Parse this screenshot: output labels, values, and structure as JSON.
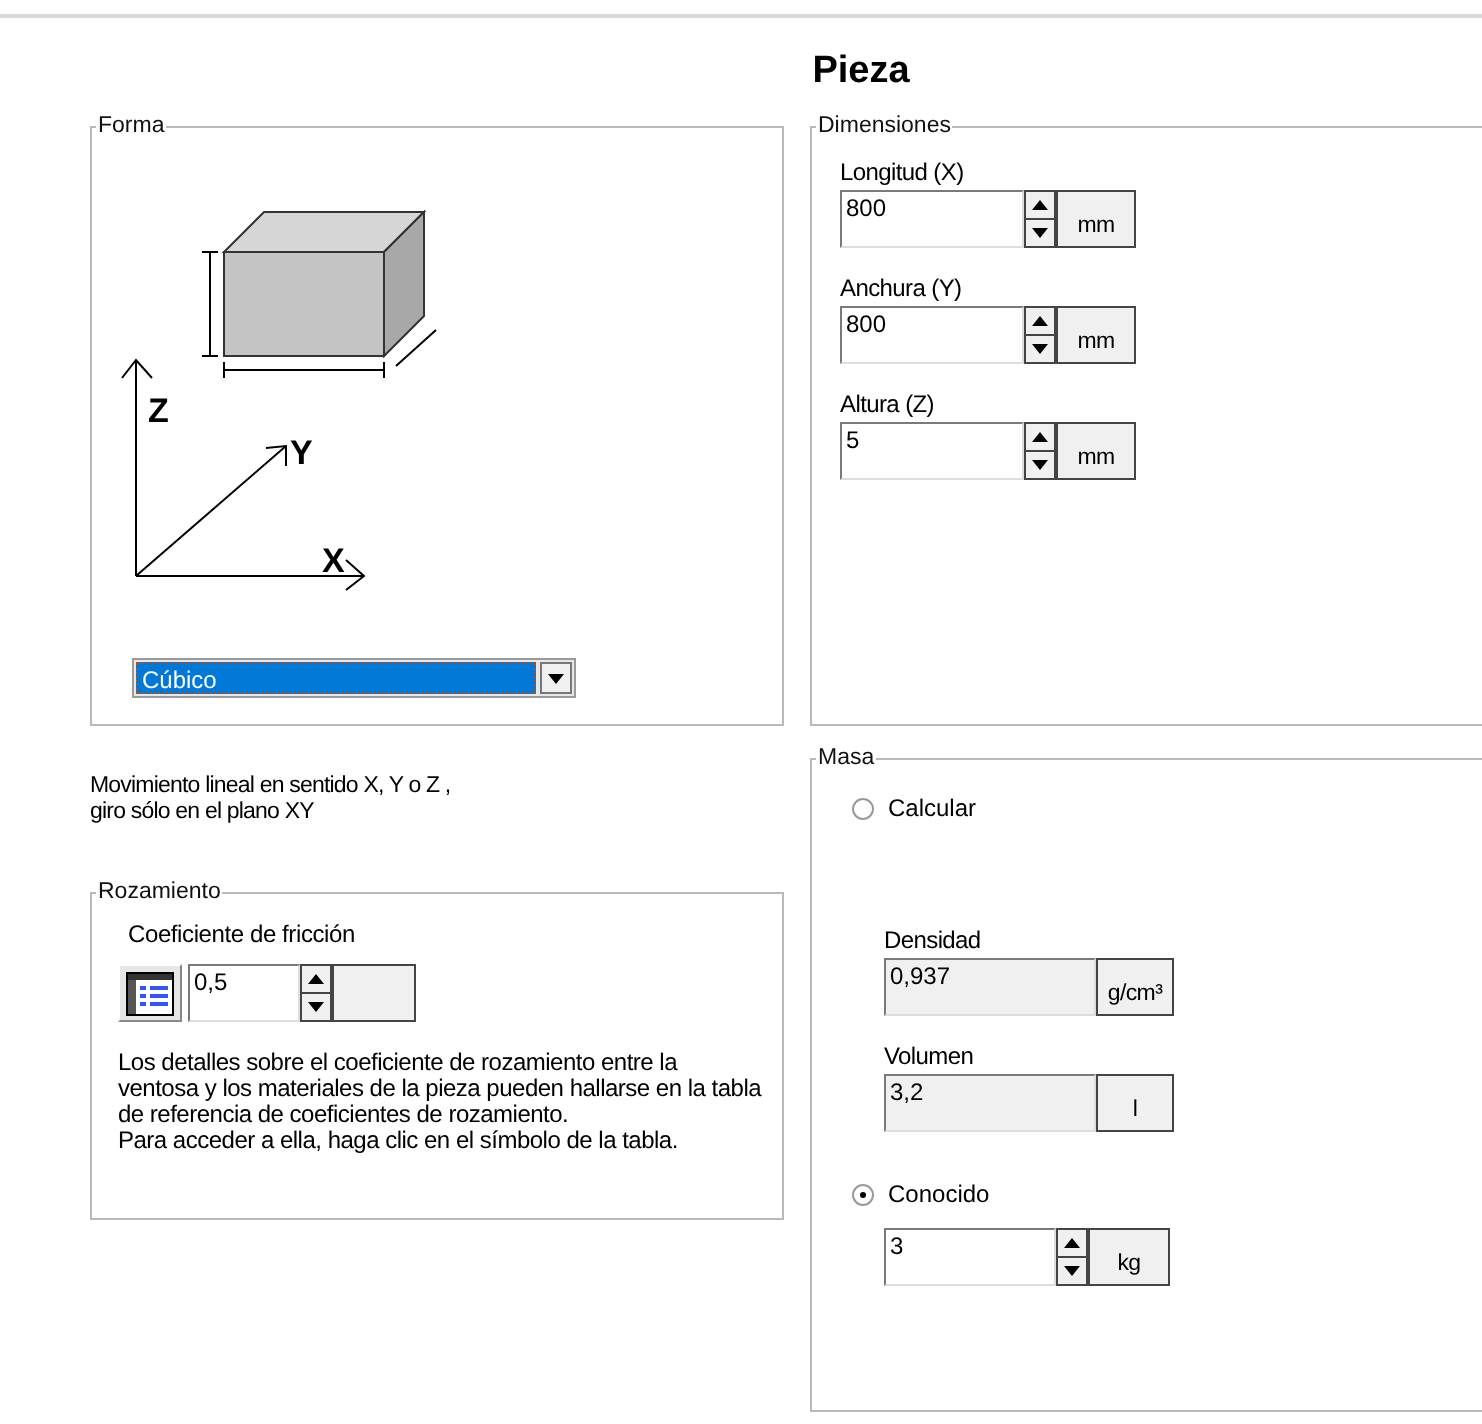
{
  "title": "Pieza",
  "shape": {
    "legend": "Forma",
    "axis_labels": [
      "Z",
      "Y",
      "X"
    ],
    "dropdown": {
      "value": "Cúbico"
    }
  },
  "dimensions": {
    "legend": "Dimensiones",
    "fields": [
      {
        "label": "Longitud (X)",
        "value": "800",
        "unit": "mm",
        "kind": "spin"
      },
      {
        "label": "Anchura (Y)",
        "value": "800",
        "unit": "mm",
        "kind": "spin"
      },
      {
        "label": "Altura (Z)",
        "value": "5",
        "unit": "mm",
        "kind": "spin"
      }
    ]
  },
  "motion_note": "Movimiento lineal en sentido X, Y o Z ,\ngiro sólo en el plano XY",
  "friction": {
    "legend": "Rozamiento",
    "label": "Coeficiente de fricción",
    "field": {
      "value": "0,5",
      "kind": "spin"
    },
    "note": "Los detalles sobre el coeficiente de rozamiento entre la\nventosa y los materiales de la pieza pueden hallarse en la tabla\nde referencia de coeficientes de rozamiento.\nPara acceder a ella, haga clic en el símbolo de la tabla."
  },
  "mass": {
    "legend": "Masa",
    "calculate": {
      "label": "Calcular",
      "selected": false,
      "fields": [
        {
          "label": "Densidad",
          "value": "0,937",
          "unit": "g/cm³",
          "kind": "readonly"
        },
        {
          "label": "Volumen",
          "value": "3,2",
          "unit": "l",
          "kind": "readonly"
        }
      ]
    },
    "known": {
      "label": "Conocido",
      "selected": true,
      "field": {
        "value": "3",
        "unit": "kg",
        "kind": "spin"
      }
    }
  }
}
